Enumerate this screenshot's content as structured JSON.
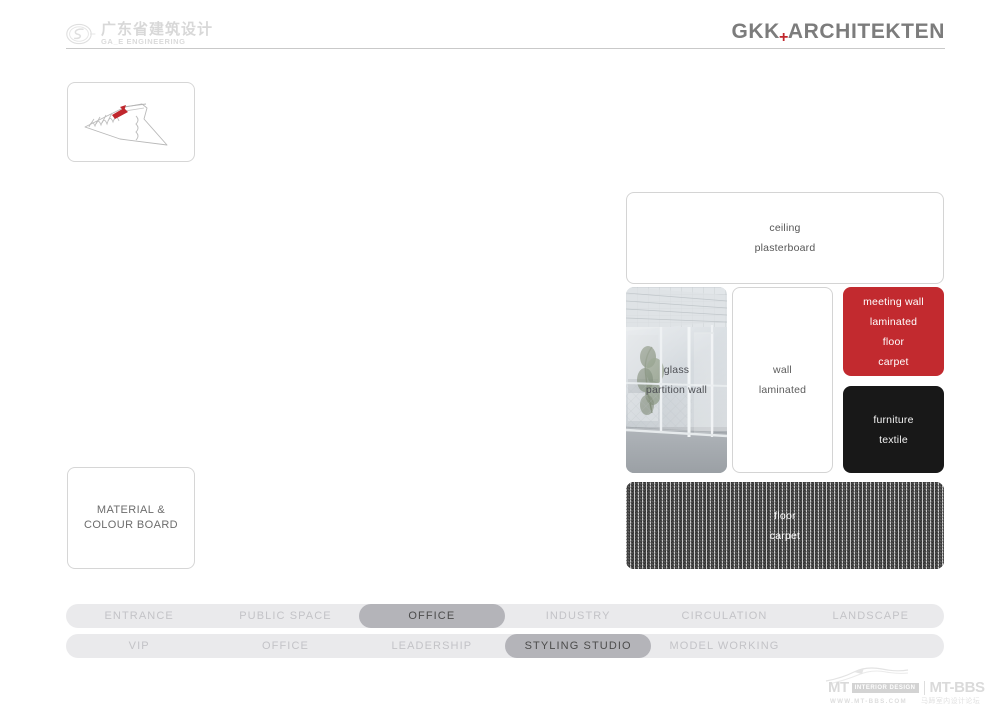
{
  "header": {
    "left_brand_cn": "广东省建筑设计",
    "left_brand_en": "GA_E ENGINEERING",
    "right_brand_main": "GKK",
    "right_brand_plus": "+",
    "right_brand_sub": "ARCHITEKTEN",
    "accent_red": "#c0272d",
    "rule_color": "#c9c9c9"
  },
  "left_column": {
    "plan_icon_name": "site-plan-sketch-icon",
    "material_board": {
      "line1": "MATERIAL &",
      "line2": "COLOUR BOARD"
    }
  },
  "samples": {
    "ceiling": {
      "line1": "ceiling",
      "line2": "plasterboard",
      "background": "#ffffff",
      "text_color": "#565656"
    },
    "glass": {
      "line1": "glass",
      "line2": "partition wall",
      "background": "photo-glass-partition-office",
      "text_color": "#4e5055"
    },
    "wall": {
      "line1": "wall",
      "line2": "laminated",
      "background": "#ffffff",
      "text_color": "#5c5c5c"
    },
    "meeting_wall": {
      "line1": "meeting wall",
      "line2": "laminated",
      "line3": "floor",
      "line4": "carpet",
      "background": "#c22a2f",
      "text_color": "#ffffff"
    },
    "furniture": {
      "line1": "furniture",
      "line2": "textile",
      "background": "#181818",
      "text_color": "#f2f2f2"
    },
    "floor": {
      "line1": "floor",
      "line2": "carpet",
      "background": "texture-striped-carpet",
      "text_color": "#ffffff"
    }
  },
  "nav_primary": {
    "items": [
      {
        "label": "ENTRANCE",
        "active": false
      },
      {
        "label": "PUBLIC SPACE",
        "active": false
      },
      {
        "label": "OFFICE",
        "active": true
      },
      {
        "label": "INDUSTRY",
        "active": false
      },
      {
        "label": "CIRCULATION",
        "active": false
      },
      {
        "label": "LANDSCAPE",
        "active": false
      }
    ]
  },
  "nav_secondary": {
    "items": [
      {
        "label": "VIP",
        "active": false
      },
      {
        "label": "OFFICE",
        "active": false
      },
      {
        "label": "LEADERSHIP",
        "active": false
      },
      {
        "label": "STYLING STUDIO",
        "active": true
      },
      {
        "label": "MODEL WORKING",
        "active": false
      }
    ]
  },
  "watermark": {
    "mt": "MT",
    "badge": "INTERIOR DESIGN",
    "bbs": "MT-BBS",
    "url": "WWW.MT-BBS.COM",
    "cn": "马蹄室内设计论坛"
  }
}
